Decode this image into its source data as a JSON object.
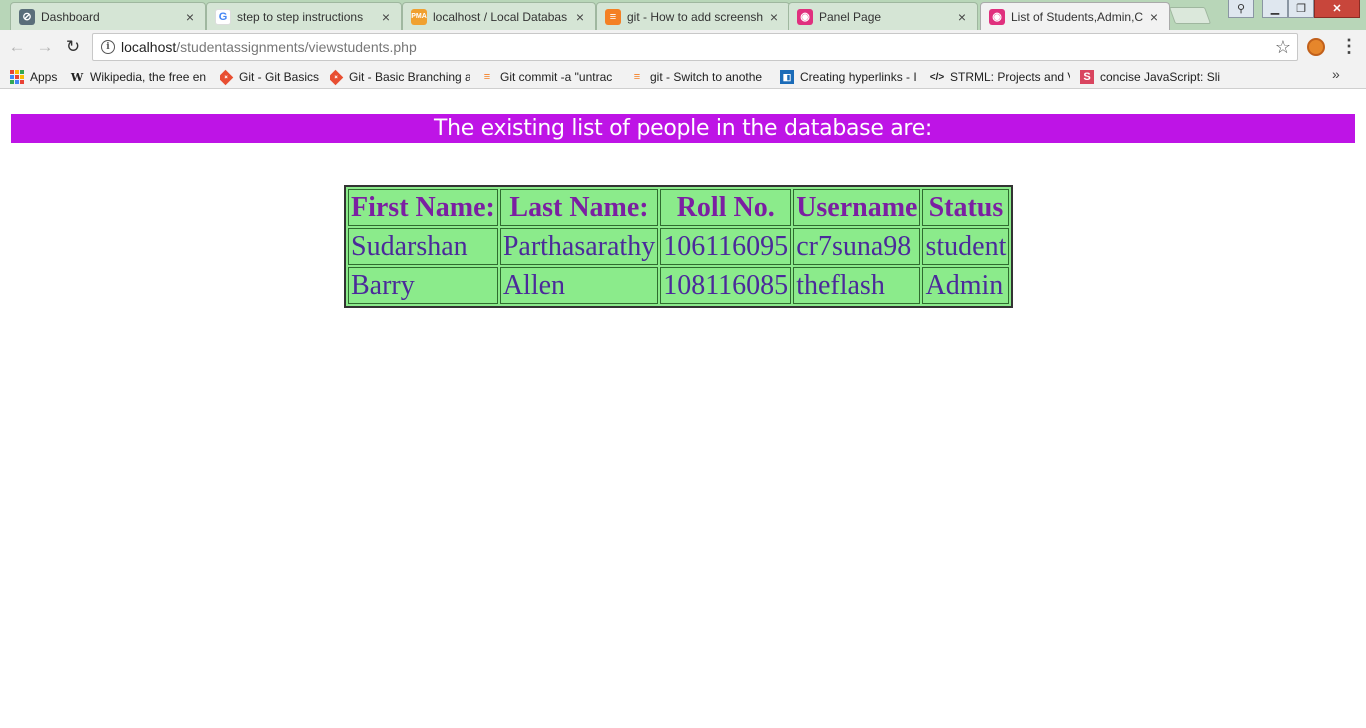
{
  "browser": {
    "tabs": [
      {
        "title": "Dashboard",
        "icon": "dashboard-icon"
      },
      {
        "title": "step to step instructions",
        "icon": "google-icon"
      },
      {
        "title": "localhost / Local Databas",
        "icon": "phpmyadmin-icon"
      },
      {
        "title": "git - How to add screensh",
        "icon": "stackoverflow-icon"
      },
      {
        "title": "Panel Page",
        "icon": "page-icon"
      },
      {
        "title": "List of Students,Admin,Cl",
        "icon": "page-icon"
      }
    ],
    "url": {
      "host": "localhost",
      "path": "/studentassignments/viewstudents.php"
    },
    "bookmarks": [
      {
        "label": "Apps",
        "icon": "apps-grid-icon"
      },
      {
        "label": "Wikipedia, the free en",
        "icon": "wikipedia-icon"
      },
      {
        "label": "Git - Git Basics",
        "icon": "git-icon"
      },
      {
        "label": "Git - Basic Branching a",
        "icon": "git-icon"
      },
      {
        "label": "Git commit -a \"untrac",
        "icon": "stackoverflow-icon"
      },
      {
        "label": "git - Switch to anothe",
        "icon": "stackoverflow-icon"
      },
      {
        "label": "Creating hyperlinks - I",
        "icon": "book-icon"
      },
      {
        "label": "STRML: Projects and V",
        "icon": "code-icon"
      },
      {
        "label": "concise JavaScript: Sli",
        "icon": "slides-icon"
      }
    ]
  },
  "page": {
    "banner": "The existing list of people in the database are:",
    "table": {
      "headers": [
        "First Name:",
        "Last Name:",
        "Roll No.",
        "Username",
        "Status"
      ],
      "rows": [
        [
          "Sudarshan",
          "Parthasarathy",
          "106116095",
          "cr7suna98",
          "student"
        ],
        [
          "Barry",
          "Allen",
          "108116085",
          "theflash",
          "Admin"
        ]
      ]
    }
  },
  "colors": {
    "banner_bg": "#be14e6",
    "table_bg": "#8beb8b",
    "text": "#7b1fa2"
  }
}
